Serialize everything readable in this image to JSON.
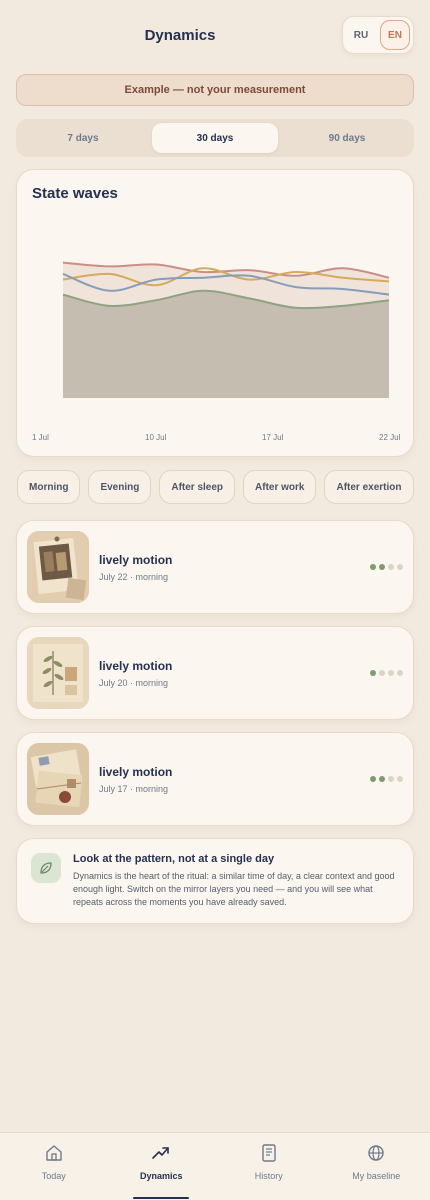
{
  "header": {
    "title": "Dynamics",
    "languages": [
      "RU",
      "EN"
    ],
    "active_language": "EN"
  },
  "banner": {
    "text": "Example — not your measurement"
  },
  "period_tabs": [
    {
      "label": "7 days",
      "active": false
    },
    {
      "label": "30 days",
      "active": true
    },
    {
      "label": "90 days",
      "active": false
    }
  ],
  "chart_card": {
    "title": "State waves"
  },
  "chart_data": {
    "type": "line",
    "title": "State waves",
    "x_tick_labels": [
      "1 Jul",
      "10 Jul",
      "17 Jul",
      "22 Jul"
    ],
    "x": [
      1,
      4,
      7,
      10,
      13,
      16,
      19,
      22
    ],
    "ylim": [
      0,
      10
    ],
    "grid": false,
    "legend": "none",
    "series": [
      {
        "color": "#c98e86",
        "values": [
          7.2,
          7.0,
          7.1,
          6.7,
          6.8,
          6.5,
          6.9,
          6.4
        ]
      },
      {
        "color": "#d4aa5c",
        "values": [
          6.3,
          6.6,
          6.0,
          6.9,
          6.3,
          6.7,
          6.4,
          6.2
        ]
      },
      {
        "color": "#859dbb",
        "values": [
          6.6,
          5.7,
          6.3,
          6.4,
          6.5,
          5.9,
          5.8,
          5.5
        ]
      },
      {
        "color": "#8fa381",
        "values": [
          5.5,
          4.9,
          5.2,
          5.7,
          5.3,
          4.8,
          4.9,
          5.2
        ]
      }
    ],
    "area_fill": "#c5bdb0"
  },
  "filters": [
    "Morning",
    "Evening",
    "After sleep",
    "After work",
    "After exertion"
  ],
  "entries": [
    {
      "title": "lively motion",
      "date": "July 22 · morning",
      "level": 2,
      "max": 4
    },
    {
      "title": "lively motion",
      "date": "July 20 · morning",
      "level": 1,
      "max": 4
    },
    {
      "title": "lively motion",
      "date": "July 17 · morning",
      "level": 2,
      "max": 4
    }
  ],
  "tip": {
    "title": "Look at the pattern, not at a single day",
    "text": "Dynamics is the heart of the ritual: a similar time of day, a clear context and good enough light. Switch on the mirror layers you need — and you will see what repeats across the moments you have already saved.",
    "icon": "leaf-icon"
  },
  "nav": [
    {
      "label": "Today",
      "icon": "home-icon",
      "active": false
    },
    {
      "label": "Dynamics",
      "icon": "trend-icon",
      "active": true
    },
    {
      "label": "History",
      "icon": "book-icon",
      "active": false
    },
    {
      "label": "My baseline",
      "icon": "globe-icon",
      "active": false
    }
  ],
  "colors": {
    "accent": "#253150",
    "dot_on": "#7f9a6f",
    "dot_off": "#d9d6c8"
  }
}
